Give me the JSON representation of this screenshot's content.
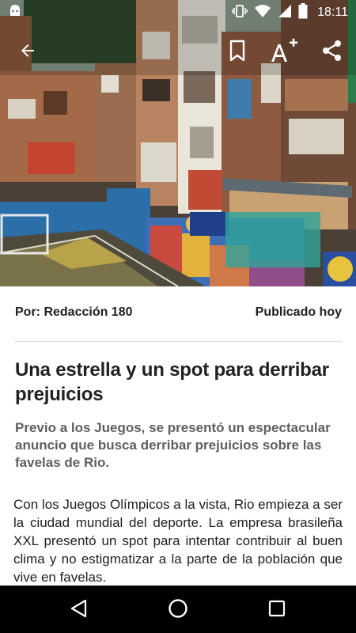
{
  "status_bar": {
    "time": "18:11",
    "icons": [
      "android-notification-icon",
      "vibrate-icon",
      "wifi-icon",
      "signal-icon",
      "battery-icon"
    ]
  },
  "toolbar": {
    "icons": [
      "back-arrow-icon",
      "bookmark-icon",
      "font-size-icon",
      "share-icon"
    ]
  },
  "article": {
    "author": "Por: Redacción 180",
    "published": "Publicado hoy",
    "title": "Una estrella y un spot para derribar prejuicios",
    "subtitle": "Previo a los Juegos, se presentó un espectacular anuncio que busca derribar prejuicios sobre las favelas de Rio.",
    "body": "Con los Juegos Olímpicos a la vista, Rio empieza a ser la ciudad mundial del deporte. La empresa brasileña XXL presentó un spot para intentar contribuir al buen clima y no estigmatizar a la parte de la población que vive en favelas."
  },
  "nav_bar": {
    "icons": [
      "nav-back-icon",
      "nav-home-icon",
      "nav-recents-icon"
    ]
  },
  "colors": {
    "text": "#212121",
    "subtitle": "#5f5f5f",
    "divider": "#d6d6d6",
    "nav_bg": "#000000"
  }
}
